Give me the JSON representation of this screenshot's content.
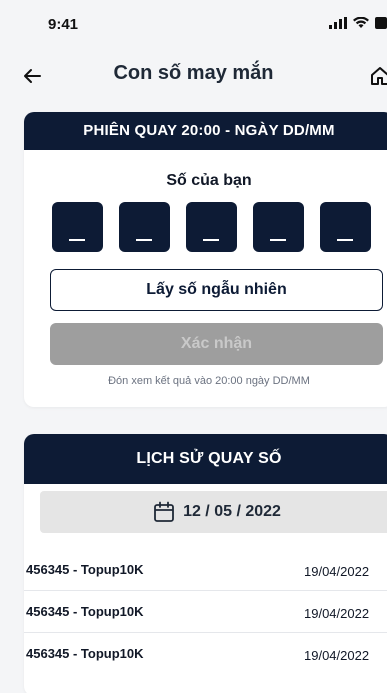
{
  "status_bar": {
    "time": "9:41"
  },
  "nav": {
    "title": "Con số may mắn"
  },
  "draw": {
    "header": "PHIÊN QUAY 20:00 - NGÀY DD/MM",
    "subtitle": "Số của bạn",
    "digits": [
      "_",
      "_",
      "_",
      "_",
      "_"
    ],
    "random_label": "Lấy số ngẫu nhiên",
    "confirm_label": "Xác nhận",
    "note": "Đón xem kết quả vào 20:00 ngày DD/MM"
  },
  "history": {
    "header": "LỊCH SỬ QUAY SỐ",
    "date": "12 / 05 / 2022",
    "rows": [
      {
        "title": "456345 - Topup10K",
        "date": "19/04/2022"
      },
      {
        "title": "456345 - Topup10K",
        "date": "19/04/2022"
      },
      {
        "title": "456345 - Topup10K",
        "date": "19/04/2022"
      }
    ]
  },
  "colors": {
    "navy": "#0d1b35",
    "background": "#f4f5f7",
    "disabled_button": "#9e9e9e",
    "date_picker_bg": "#e5e5e5"
  }
}
